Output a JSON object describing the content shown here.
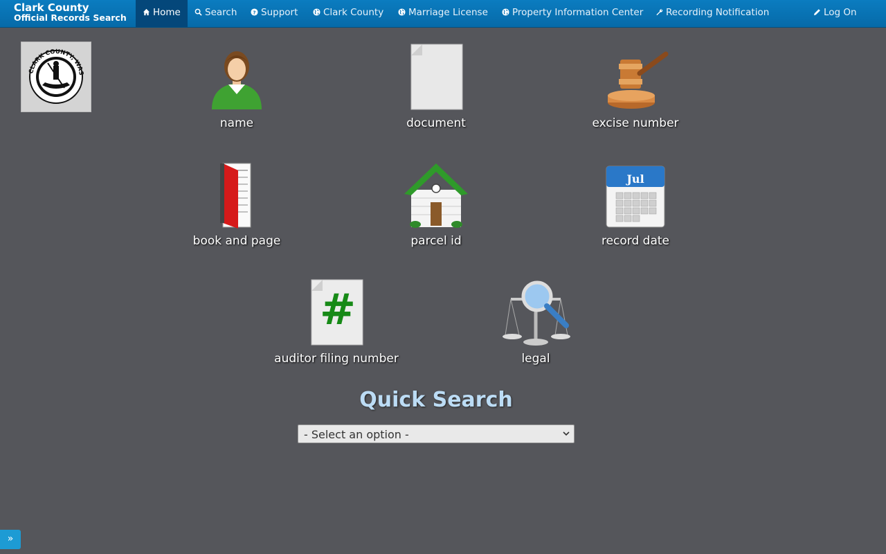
{
  "brand": {
    "line1": "Clark County",
    "line2": "Official Records Search"
  },
  "nav": {
    "home": "Home",
    "search": "Search",
    "support": "Support",
    "clark_county": "Clark County",
    "marriage_license": "Marriage License",
    "property_info": "Property Information Center",
    "recording_notification": "Recording Notification",
    "log_on": "Log On"
  },
  "seal": {
    "text": "CLARK COUNTY, WASHINGTON"
  },
  "tiles": {
    "name": "name",
    "document": "document",
    "excise_number": "excise number",
    "book_and_page": "book and page",
    "parcel_id": "parcel id",
    "record_date": "record date",
    "auditor_filing_number": "auditor filing number",
    "legal": "legal"
  },
  "calendar": {
    "month": "Jul"
  },
  "auditor_symbol": "#",
  "quick_search": {
    "title": "Quick Search",
    "selected": "- Select an option -"
  },
  "expander": {
    "label": "»"
  }
}
